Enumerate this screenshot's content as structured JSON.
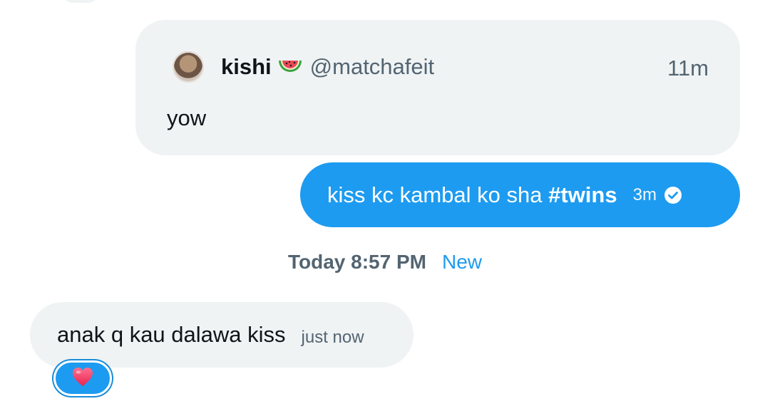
{
  "quoted_message": {
    "author_name": "kishi",
    "author_emoji": "watermelon-emoji",
    "author_handle": "@matchafeit",
    "time": "11m",
    "text": "yow"
  },
  "sent_message": {
    "text": "kiss kc kambal ko sha",
    "hashtag": "#twins",
    "time": "3m",
    "status_icon": "check-circle-icon"
  },
  "divider": {
    "label": "Today 8:57 PM",
    "new_label": "New"
  },
  "received_message": {
    "text": "anak q kau dalawa kiss",
    "time": "just now",
    "reaction": "heart-emoji"
  },
  "colors": {
    "accent": "#1d9bf0",
    "bubble_gray": "#eff3f4",
    "secondary_text": "#536471",
    "primary_text": "#0f1419"
  }
}
